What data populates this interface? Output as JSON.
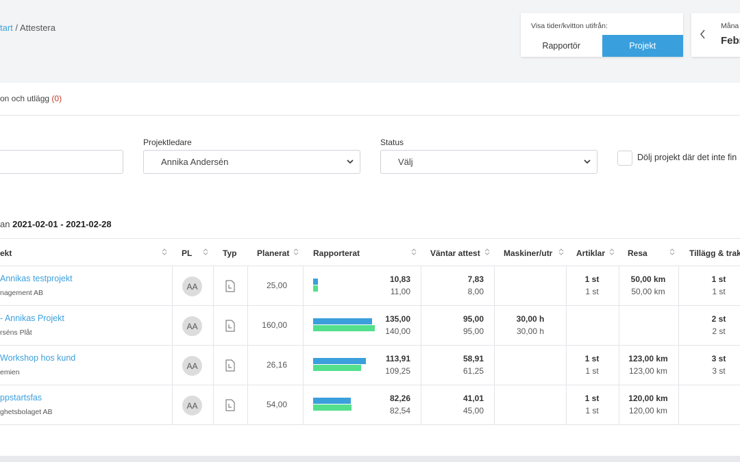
{
  "breadcrumb": {
    "link": "tart",
    "sep": "/",
    "current": "Attestera"
  },
  "view_toggle": {
    "label": "Visa tider/kvitton utifrån:",
    "options": [
      "Rapportör",
      "Projekt"
    ],
    "selected": "Projekt"
  },
  "month": {
    "label": "Måna",
    "value": "Febr"
  },
  "tab": {
    "label": "on och utlägg",
    "count": "(0)"
  },
  "filters": {
    "projektledare_label": "Projektledare",
    "projektledare_value": "Annika Andersén",
    "status_label": "Status",
    "status_value": "Välj",
    "hide_label": "Dölj projekt där det inte fin"
  },
  "period": {
    "prefix": "an",
    "range": "2021-02-01 - 2021-02-28"
  },
  "columns": {
    "project": "ekt",
    "pl": "PL",
    "typ": "Typ",
    "planerat": "Planerat",
    "rapporterat": "Rapporterat",
    "vantar": "Väntar attest",
    "maskiner": "Maskiner/utr",
    "artiklar": "Artiklar",
    "resa": "Resa",
    "tillagg": "Tillägg & trak"
  },
  "rows": [
    {
      "name": "Annikas testprojekt",
      "customer": "nagement AB",
      "pl": "AA",
      "planerat": "25,00",
      "rap_top": "10,83",
      "rap_bot": "11,00",
      "bar_blue": 0.08,
      "bar_green": 0.08,
      "vant_top": "7,83",
      "vant_bot": "8,00",
      "mask_top": "",
      "mask_bot": "",
      "art_top": "1 st",
      "art_bot": "1 st",
      "resa_top": "50,00 km",
      "resa_bot": "50,00 km",
      "till_top": "1 st",
      "till_bot": "1 st"
    },
    {
      "name": "- Annikas Projekt",
      "customer": "rséns Plåt",
      "pl": "AA",
      "planerat": "160,00",
      "rap_top": "135,00",
      "rap_bot": "140,00",
      "bar_blue": 0.96,
      "bar_green": 1.0,
      "vant_top": "95,00",
      "vant_bot": "95,00",
      "mask_top": "30,00 h",
      "mask_bot": "30,00 h",
      "art_top": "",
      "art_bot": "",
      "resa_top": "",
      "resa_bot": "",
      "till_top": "2 st",
      "till_bot": "2 st"
    },
    {
      "name": "Workshop hos kund",
      "customer": "emien",
      "pl": "AA",
      "planerat": "26,16",
      "rap_top": "113,91",
      "rap_bot": "109,25",
      "bar_blue": 0.86,
      "bar_green": 0.78,
      "vant_top": "58,91",
      "vant_bot": "61,25",
      "mask_top": "",
      "mask_bot": "",
      "art_top": "1 st",
      "art_bot": "1 st",
      "resa_top": "123,00 km",
      "resa_bot": "123,00 km",
      "till_top": "3 st",
      "till_bot": "3 st"
    },
    {
      "name": "ppstartsfas",
      "customer": "ghetsbolaget AB",
      "pl": "AA",
      "planerat": "54,00",
      "rap_top": "82,26",
      "rap_bot": "82,54",
      "bar_blue": 0.61,
      "bar_green": 0.62,
      "vant_top": "41,01",
      "vant_bot": "45,00",
      "mask_top": "",
      "mask_bot": "",
      "art_top": "1 st",
      "art_bot": "1 st",
      "resa_top": "120,00 km",
      "resa_bot": "120,00 km",
      "till_top": "",
      "till_bot": ""
    }
  ],
  "colors": {
    "accent": "#3aa0dd",
    "bar_blue": "#3b9fdb",
    "bar_green": "#53df8c",
    "count": "#c0392b"
  }
}
